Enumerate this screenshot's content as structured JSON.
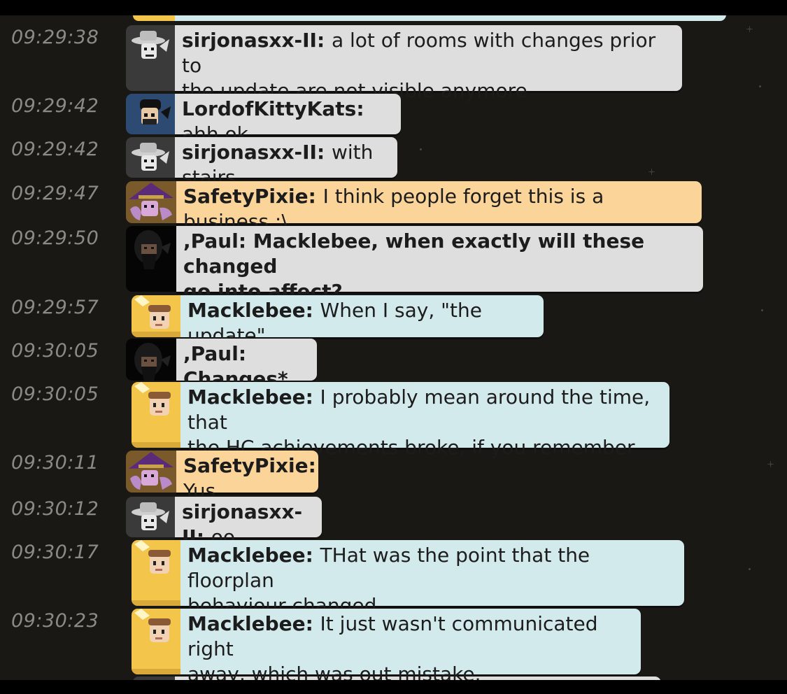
{
  "messages": [
    {
      "time": "09:29:38",
      "user": "sirjonasxx-II",
      "text": "a lot of rooms with changes prior to",
      "text2": "the update are not visible anymore",
      "style": "grey",
      "avatar": "cowboy-hat-avatar"
    },
    {
      "time": "09:29:42",
      "user": "LordofKittyKats",
      "text": "ahh ok",
      "style": "grey",
      "avatar": "dark-hair-avatar"
    },
    {
      "time": "09:29:42",
      "user": "sirjonasxx-II",
      "text": "with stairs",
      "style": "grey",
      "avatar": "cowboy-hat-avatar"
    },
    {
      "time": "09:29:47",
      "user": "SafetyPixie",
      "text": "I think people forget this is a business :\\",
      "style": "orange",
      "avatar": "witch-hat-avatar"
    },
    {
      "time": "09:29:50",
      "user": ",Paul",
      "text": "Macklebee, when exactly will these changed",
      "text2": "go into affect?",
      "style": "grey",
      "avatar": "hooded-beard-avatar"
    },
    {
      "time": "09:29:57",
      "user": "Macklebee",
      "text": "When I say, \"the update\".",
      "style": "blue",
      "avatar": "staff-avatar"
    },
    {
      "time": "09:30:05",
      "user": ",Paul",
      "text": "Changes*",
      "style": "grey",
      "avatar": "hooded-beard-avatar"
    },
    {
      "time": "09:30:05",
      "user": "Macklebee",
      "text": "I probably mean around the time, that",
      "text2": "the HC achievements broke, if you remember that.",
      "style": "blue",
      "avatar": "staff-avatar"
    },
    {
      "time": "09:30:11",
      "user": "SafetyPixie",
      "text": "Yus",
      "style": "orange",
      "avatar": "witch-hat-avatar"
    },
    {
      "time": "09:30:12",
      "user": "sirjonasxx-II",
      "text": "oo",
      "style": "grey",
      "avatar": "cowboy-hat-avatar"
    },
    {
      "time": "09:30:17",
      "user": "Macklebee",
      "text": "THat was the point that the floorplan",
      "text2": "behaviour changed.",
      "style": "blue",
      "avatar": "staff-avatar"
    },
    {
      "time": "09:30:23",
      "user": "Macklebee",
      "text": "It just wasn't communicated right",
      "text2": "away, which was out mistake.",
      "style": "blue",
      "avatar": "staff-avatar"
    }
  ],
  "colors": {
    "background": "#1a1815",
    "bubble_grey": "#dedede",
    "bubble_orange": "#fbd49a",
    "bubble_blue": "#d3eaed",
    "staff_badge": "#f3c54a"
  }
}
